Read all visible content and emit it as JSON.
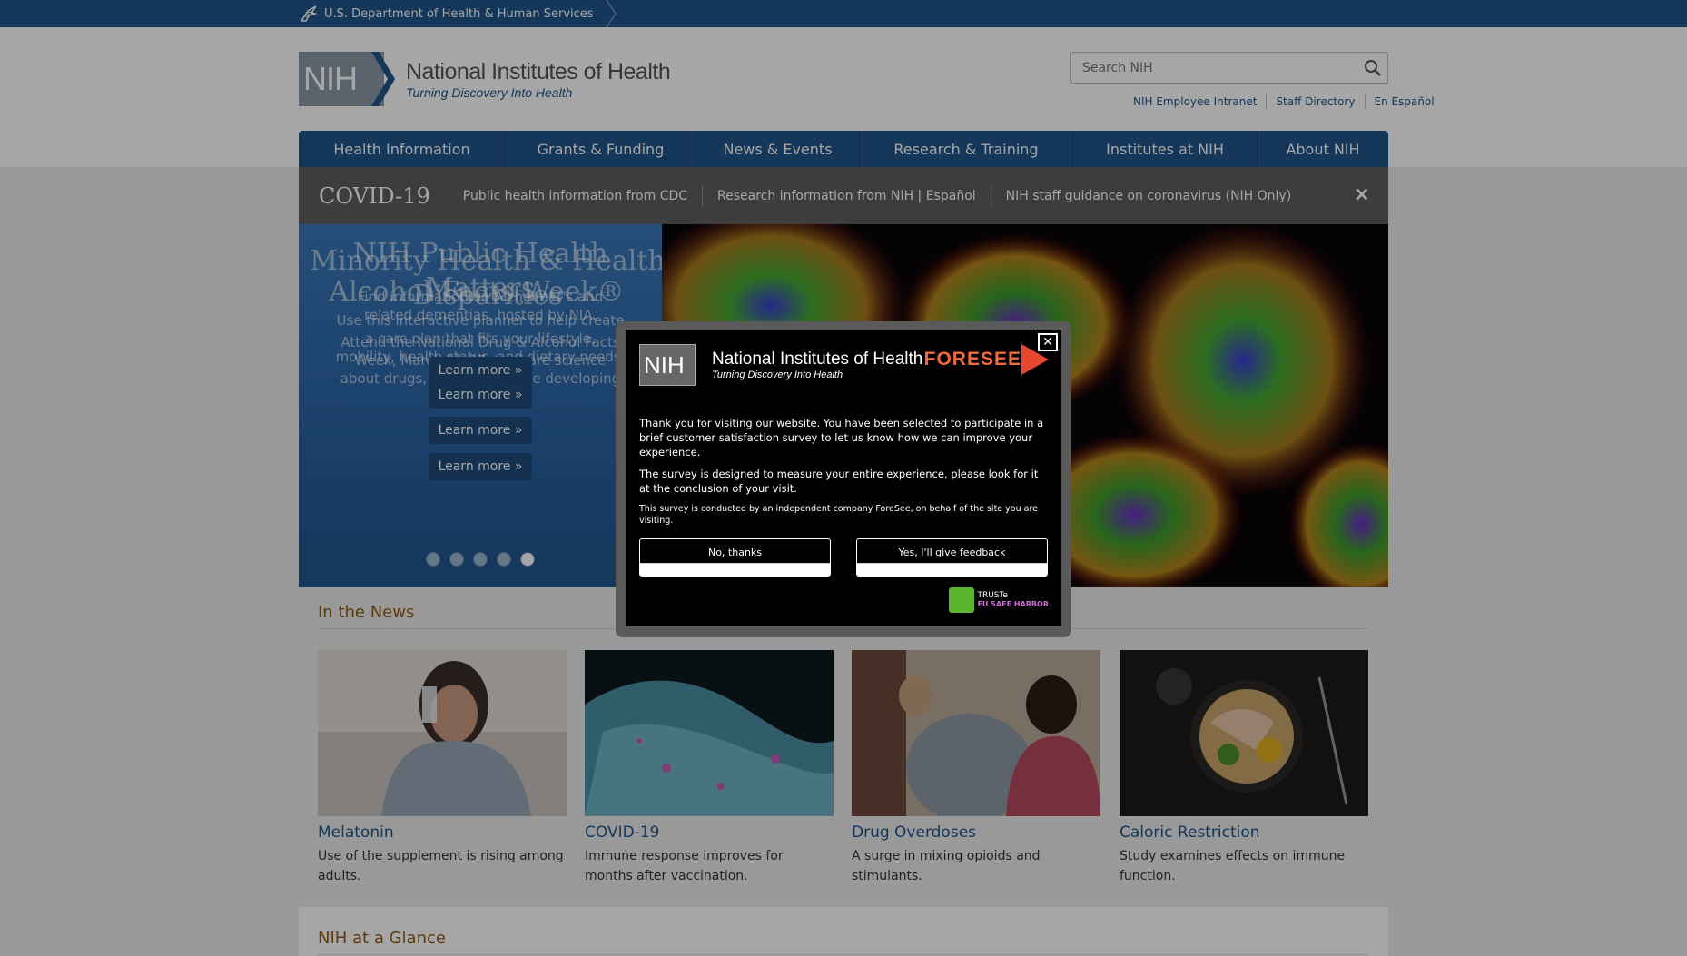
{
  "hhs": {
    "label": "U.S. Department of Health & Human Services"
  },
  "logo": {
    "abbr": "NIH",
    "title": "National Institutes of Health",
    "tagline": "Turning Discovery Into Health"
  },
  "search": {
    "placeholder": "Search NIH"
  },
  "toplinks": [
    "NIH Employee Intranet",
    "Staff Directory",
    "En Español"
  ],
  "nav": [
    "Health Information",
    "Grants & Funding",
    "News & Events",
    "Research & Training",
    "Institutes at NIH",
    "About NIH"
  ],
  "covid": {
    "title": "COVID-19",
    "links": [
      "Public health information from CDC",
      "Research information from NIH | Español",
      "NIH staff guidance on coronavirus (NIH Only)"
    ],
    "close": "×"
  },
  "hero": {
    "title_layers": [
      "NIH Public Health Matters",
      "Minority Health & Health Disparities",
      "Alcohol Facts Week®"
    ],
    "body_layers": [
      "Find information on Alzheimer's and related dementias, hosted by NIA.",
      "Use this interactive planner to help create a care plan that fits your lifestyle, mobility, health status, and dietary needs.",
      "Attend the National Drug & Alcohol Facts Week, March 21-27, to share science about drugs, alcohol, and the developing teen brain."
    ],
    "learn_more": "Learn more »",
    "dots_count": 5,
    "active_dot": 4
  },
  "modal": {
    "close": "✕",
    "abbr": "NIH",
    "org": "National Institutes of Health",
    "tagline": "Turning Discovery Into Health",
    "brand": "FORESEE",
    "p1": "Thank you for visiting our website. You have been selected to participate in a brief customer satisfaction survey to let us know how we can improve your experience.",
    "p2": "The survey is designed to measure your entire experience, please look for it at the conclusion of your visit.",
    "p3": "This survey is conducted by an independent company ForeSee, on behalf of the site you are visiting.",
    "btn_no": "No, thanks",
    "btn_yes": "Yes, I'll give feedback",
    "truste": "TRUSTe",
    "truste_sub": "EU SAFE HARBOR"
  },
  "news": {
    "title": "In the News",
    "cards": [
      {
        "title": "Melatonin",
        "desc": "Use of the supplement is rising among adults."
      },
      {
        "title": "COVID-19",
        "desc": "Immune response improves for months after vaccination."
      },
      {
        "title": "Drug Overdoses",
        "desc": "A surge in mixing opioids and stimulants."
      },
      {
        "title": "Caloric Restriction",
        "desc": "Study examines effects on immune function."
      }
    ]
  },
  "glance": {
    "title": "NIH at a Glance"
  },
  "colors": {
    "brand_blue": "#20558a",
    "accent_brown": "#8a5b17",
    "covid_bar": "#5f5f5f"
  }
}
